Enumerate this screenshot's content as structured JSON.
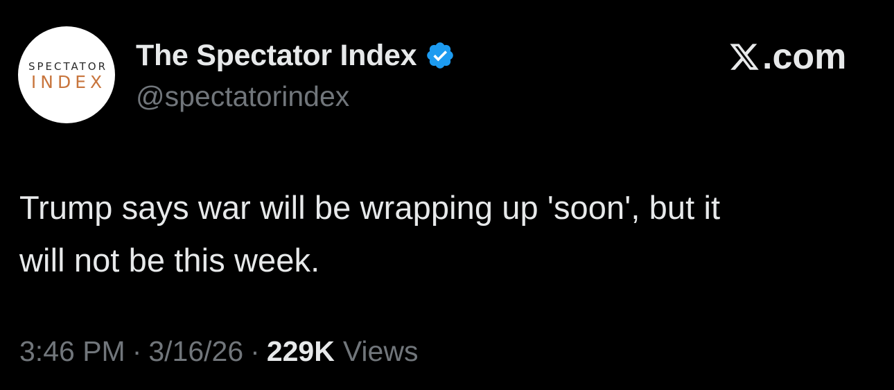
{
  "account": {
    "avatar_top": "SPECTATOR",
    "avatar_bottom": "INDEX",
    "display_name": "The Spectator Index",
    "handle": "@spectatorindex",
    "verified": true
  },
  "brand": {
    "text": ".com",
    "icon": "x-logo-icon"
  },
  "tweet": {
    "line1": "Trump says war will be wrapping up 'soon', but it",
    "line2": "will not be this week."
  },
  "meta": {
    "time": "3:46 PM",
    "separator": "·",
    "date": "3/16/26",
    "views_count": "229K",
    "views_label": "Views"
  },
  "colors": {
    "background": "#000000",
    "text_primary": "#e7e9ea",
    "text_secondary": "#71767b",
    "verified_blue": "#1d9bf0",
    "logo_orange": "#c8753d"
  }
}
